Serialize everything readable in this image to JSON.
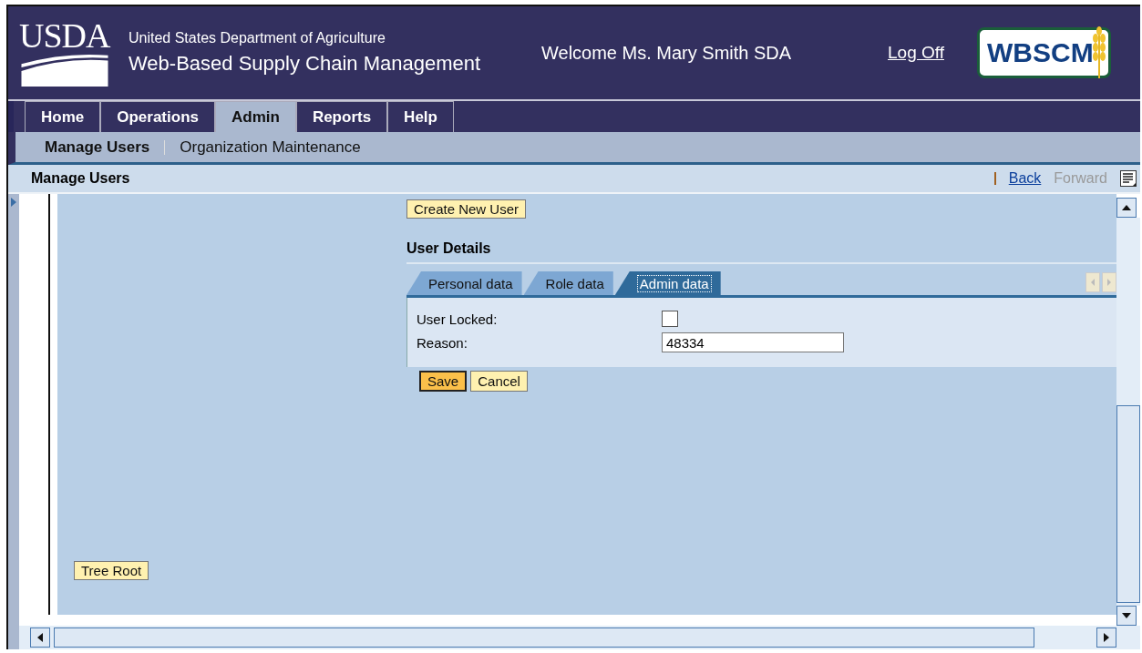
{
  "header": {
    "logo": "USDA",
    "department": "United States Department of Agriculture",
    "app_title": "Web-Based Supply Chain Management",
    "welcome": "Welcome Ms. Mary Smith SDA",
    "log_off": "Log Off",
    "brand": "WBSCM"
  },
  "tabs": [
    {
      "label": "Home",
      "selected": false
    },
    {
      "label": "Operations",
      "selected": false
    },
    {
      "label": "Admin",
      "selected": true
    },
    {
      "label": "Reports",
      "selected": false
    },
    {
      "label": "Help",
      "selected": false
    }
  ],
  "subtabs": [
    {
      "label": "Manage Users",
      "selected": true
    },
    {
      "label": "Organization Maintenance",
      "selected": false
    }
  ],
  "page_title": "Manage Users",
  "nav_links": [
    {
      "label": "Back",
      "disabled": false
    },
    {
      "label": "Forward",
      "disabled": true
    }
  ],
  "create_button": "Create New User",
  "section_title": "User Details",
  "detail_tabs": [
    {
      "label": "Personal data",
      "selected": false
    },
    {
      "label": "Role data",
      "selected": false
    },
    {
      "label": "Admin data",
      "selected": true
    }
  ],
  "fields": [
    {
      "kind": "checkbox",
      "label": "User Locked:",
      "checked": false
    },
    {
      "kind": "text",
      "label": "Reason:",
      "value": "48334"
    }
  ],
  "buttons": [
    {
      "label": "Save",
      "primary": true
    },
    {
      "label": "Cancel",
      "primary": false
    }
  ],
  "tree_root": "Tree Root"
}
